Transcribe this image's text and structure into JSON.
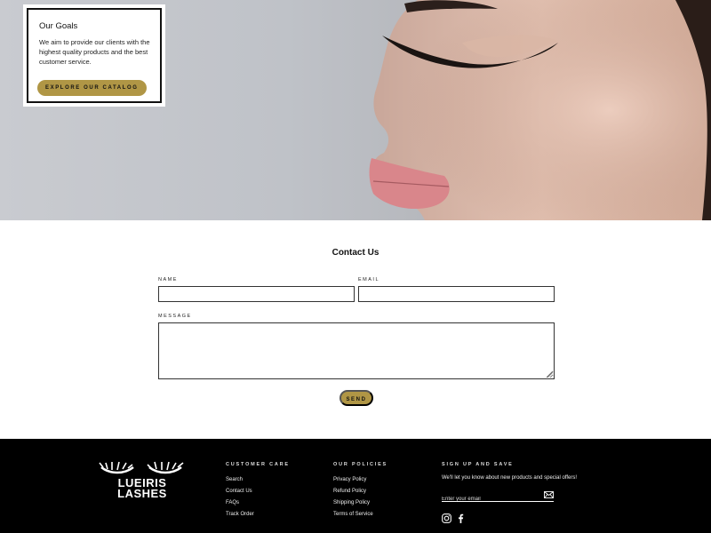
{
  "hero": {
    "card": {
      "title": "Our Goals",
      "text": "We aim to provide our clients with the highest quality products and the best customer service.",
      "button_label": "Explore our catalog"
    }
  },
  "contact": {
    "title": "Contact Us",
    "name_label": "Name",
    "email_label": "Email",
    "message_label": "Message",
    "send_label": "Send"
  },
  "footer": {
    "logo": {
      "line1": "LUEIRIS",
      "line2": "LASHES"
    },
    "customer_care": {
      "title": "Customer Care",
      "links": [
        "Search",
        "Contact Us",
        "FAQs",
        "Track Order"
      ]
    },
    "policies": {
      "title": "Our Policies",
      "links": [
        "Privacy Policy",
        "Refund Policy",
        "Shipping Policy",
        "Terms of Service"
      ]
    },
    "signup": {
      "title": "Sign up and save",
      "text": "We'll let you know about new products and special offers!",
      "email_placeholder": "Enter your email"
    },
    "social_icons": [
      "instagram-icon",
      "facebook-icon"
    ]
  },
  "colors": {
    "accent_gold": "#b09645",
    "footer_bg": "#000000"
  }
}
